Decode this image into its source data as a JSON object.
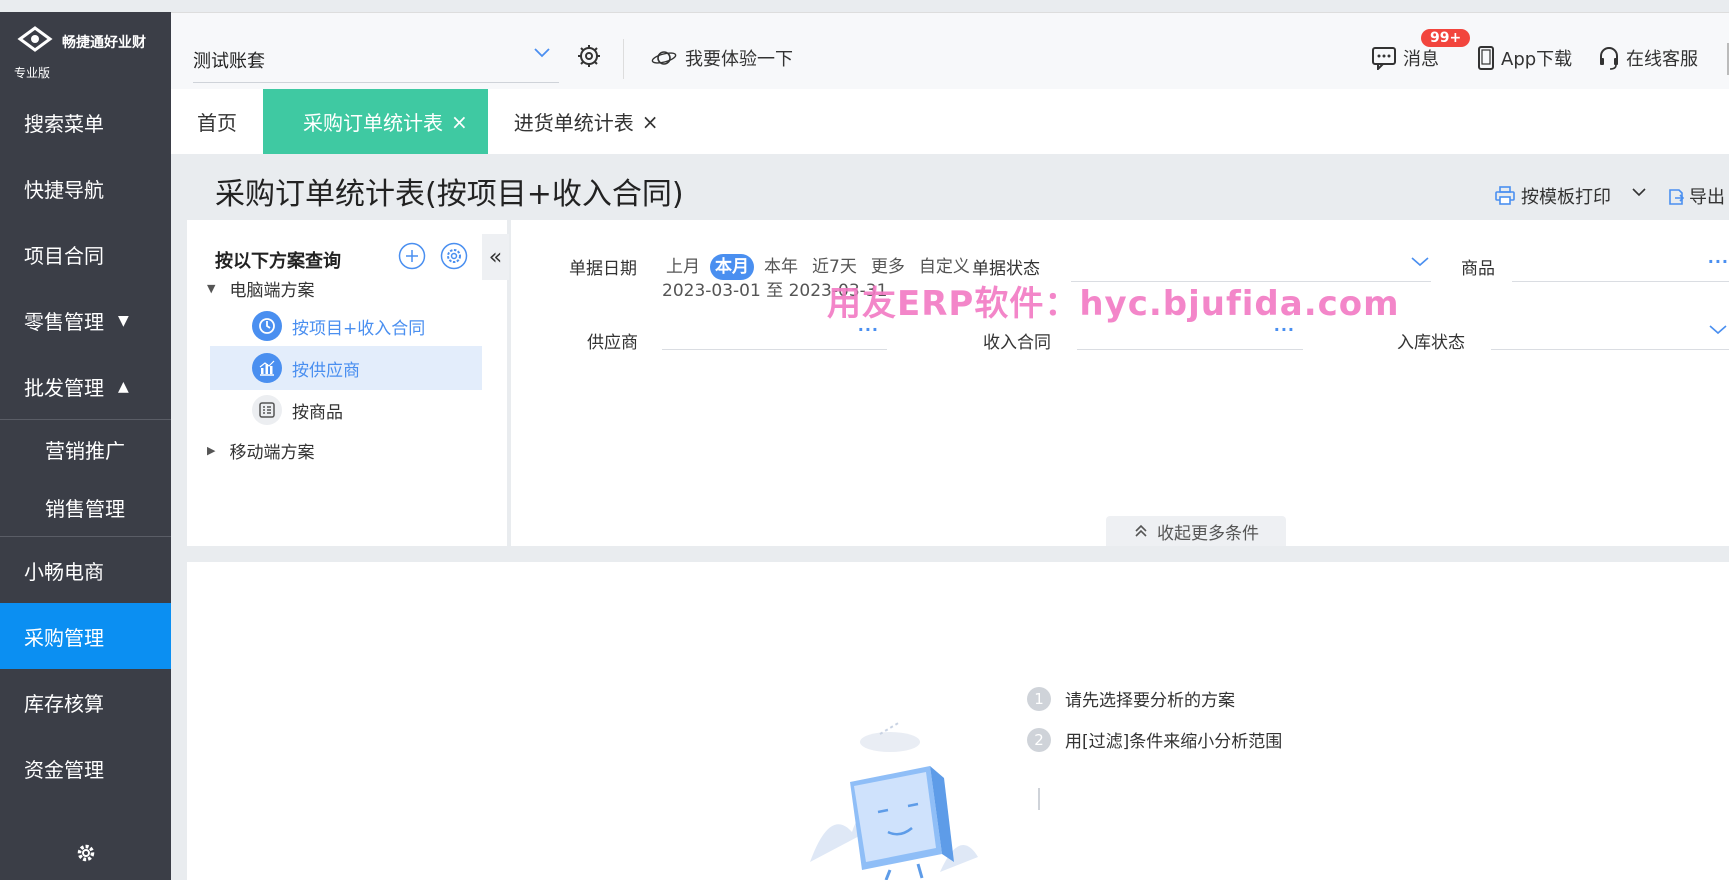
{
  "sidebar": {
    "brand": "畅捷通好业财",
    "edition": "专业版",
    "items": [
      {
        "label": "搜索菜单"
      },
      {
        "label": "快捷导航"
      },
      {
        "label": "项目合同"
      },
      {
        "label": "零售管理",
        "caret": "▼"
      },
      {
        "label": "批发管理",
        "caret": "▲"
      },
      {
        "label": "营销推广"
      },
      {
        "label": "销售管理"
      },
      {
        "label": "小畅电商"
      },
      {
        "label": "采购管理"
      },
      {
        "label": "库存核算"
      },
      {
        "label": "资金管理"
      }
    ],
    "active_color": "#0b8ff2"
  },
  "topbar": {
    "account": "测试账套",
    "try_label": "我要体验一下",
    "messages_label": "消息",
    "messages_badge": "99+",
    "app_label": "App下载",
    "service_label": "在线客服"
  },
  "tabs": [
    {
      "label": "首页"
    },
    {
      "label": "采购订单统计表",
      "close": "×"
    },
    {
      "label": "进货单统计表",
      "close": "×"
    }
  ],
  "page": {
    "title": "采购订单统计表(按项目+收入合同)",
    "print_label": "按模板打印",
    "export_label": "导出"
  },
  "scheme": {
    "title": "按以下方案查询",
    "collapse": "«",
    "pc_folder": "电脑端方案",
    "mobile_folder": "移动端方案",
    "items": [
      {
        "label": "按项目+收入合同"
      },
      {
        "label": "按供应商"
      },
      {
        "label": "按商品"
      }
    ]
  },
  "filters": {
    "date_label": "单据日期",
    "date_options": [
      "上月",
      "本月",
      "本年",
      "近7天",
      "更多",
      "自定义"
    ],
    "date_range": "2023-03-01 至 2023-03-31",
    "status_label": "单据状态",
    "product_label": "商品",
    "supplier_label": "供应商",
    "contract_label": "收入合同",
    "stock_label": "入库状态",
    "more_glyph": "···",
    "collapse_label": "收起更多条件"
  },
  "watermark": "用友ERP软件：hyc.bjufida.com",
  "empty_state": {
    "steps": [
      {
        "num": "1",
        "text": "请先选择要分析的方案"
      },
      {
        "num": "2",
        "text": "用[过滤]条件来缩小分析范围"
      }
    ]
  }
}
